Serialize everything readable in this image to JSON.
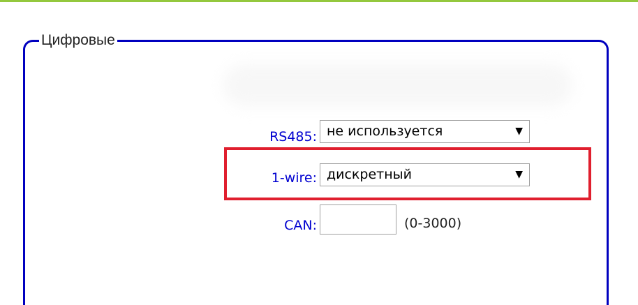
{
  "fieldset": {
    "legend": "Цифровые"
  },
  "rs485": {
    "label": "RS485:",
    "selected": "не используется",
    "arrow_icon": "triangle-down"
  },
  "one_wire": {
    "label": "1-wire:",
    "selected": "дискретный",
    "arrow_icon": "triangle-down"
  },
  "can": {
    "label": "CAN:",
    "value": "",
    "range_hint": "(0-3000)"
  },
  "colors": {
    "accent_line": "#94c83d",
    "fieldset_border": "#0000bf",
    "label_text": "#0000d0",
    "highlight": "#e01f2e"
  }
}
